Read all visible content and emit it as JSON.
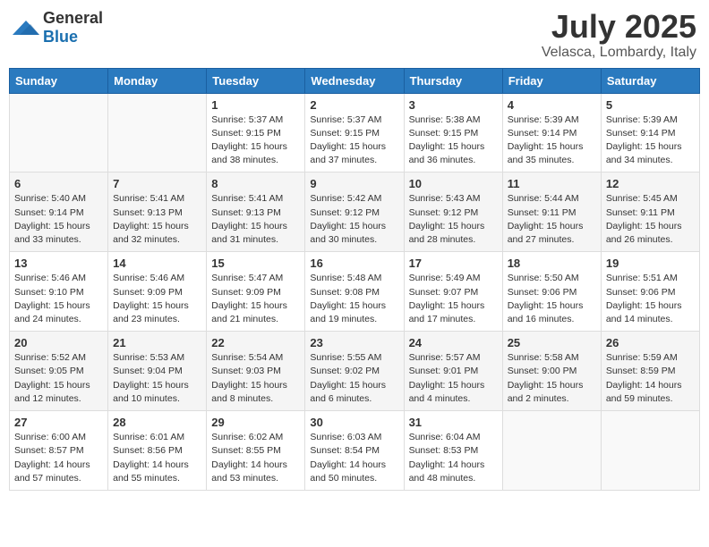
{
  "header": {
    "logo_general": "General",
    "logo_blue": "Blue",
    "month_title": "July 2025",
    "location": "Velasca, Lombardy, Italy"
  },
  "days_of_week": [
    "Sunday",
    "Monday",
    "Tuesday",
    "Wednesday",
    "Thursday",
    "Friday",
    "Saturday"
  ],
  "weeks": [
    [
      {
        "day": "",
        "sunrise": "",
        "sunset": "",
        "daylight": ""
      },
      {
        "day": "",
        "sunrise": "",
        "sunset": "",
        "daylight": ""
      },
      {
        "day": "1",
        "sunrise": "Sunrise: 5:37 AM",
        "sunset": "Sunset: 9:15 PM",
        "daylight": "Daylight: 15 hours and 38 minutes."
      },
      {
        "day": "2",
        "sunrise": "Sunrise: 5:37 AM",
        "sunset": "Sunset: 9:15 PM",
        "daylight": "Daylight: 15 hours and 37 minutes."
      },
      {
        "day": "3",
        "sunrise": "Sunrise: 5:38 AM",
        "sunset": "Sunset: 9:15 PM",
        "daylight": "Daylight: 15 hours and 36 minutes."
      },
      {
        "day": "4",
        "sunrise": "Sunrise: 5:39 AM",
        "sunset": "Sunset: 9:14 PM",
        "daylight": "Daylight: 15 hours and 35 minutes."
      },
      {
        "day": "5",
        "sunrise": "Sunrise: 5:39 AM",
        "sunset": "Sunset: 9:14 PM",
        "daylight": "Daylight: 15 hours and 34 minutes."
      }
    ],
    [
      {
        "day": "6",
        "sunrise": "Sunrise: 5:40 AM",
        "sunset": "Sunset: 9:14 PM",
        "daylight": "Daylight: 15 hours and 33 minutes."
      },
      {
        "day": "7",
        "sunrise": "Sunrise: 5:41 AM",
        "sunset": "Sunset: 9:13 PM",
        "daylight": "Daylight: 15 hours and 32 minutes."
      },
      {
        "day": "8",
        "sunrise": "Sunrise: 5:41 AM",
        "sunset": "Sunset: 9:13 PM",
        "daylight": "Daylight: 15 hours and 31 minutes."
      },
      {
        "day": "9",
        "sunrise": "Sunrise: 5:42 AM",
        "sunset": "Sunset: 9:12 PM",
        "daylight": "Daylight: 15 hours and 30 minutes."
      },
      {
        "day": "10",
        "sunrise": "Sunrise: 5:43 AM",
        "sunset": "Sunset: 9:12 PM",
        "daylight": "Daylight: 15 hours and 28 minutes."
      },
      {
        "day": "11",
        "sunrise": "Sunrise: 5:44 AM",
        "sunset": "Sunset: 9:11 PM",
        "daylight": "Daylight: 15 hours and 27 minutes."
      },
      {
        "day": "12",
        "sunrise": "Sunrise: 5:45 AM",
        "sunset": "Sunset: 9:11 PM",
        "daylight": "Daylight: 15 hours and 26 minutes."
      }
    ],
    [
      {
        "day": "13",
        "sunrise": "Sunrise: 5:46 AM",
        "sunset": "Sunset: 9:10 PM",
        "daylight": "Daylight: 15 hours and 24 minutes."
      },
      {
        "day": "14",
        "sunrise": "Sunrise: 5:46 AM",
        "sunset": "Sunset: 9:09 PM",
        "daylight": "Daylight: 15 hours and 23 minutes."
      },
      {
        "day": "15",
        "sunrise": "Sunrise: 5:47 AM",
        "sunset": "Sunset: 9:09 PM",
        "daylight": "Daylight: 15 hours and 21 minutes."
      },
      {
        "day": "16",
        "sunrise": "Sunrise: 5:48 AM",
        "sunset": "Sunset: 9:08 PM",
        "daylight": "Daylight: 15 hours and 19 minutes."
      },
      {
        "day": "17",
        "sunrise": "Sunrise: 5:49 AM",
        "sunset": "Sunset: 9:07 PM",
        "daylight": "Daylight: 15 hours and 17 minutes."
      },
      {
        "day": "18",
        "sunrise": "Sunrise: 5:50 AM",
        "sunset": "Sunset: 9:06 PM",
        "daylight": "Daylight: 15 hours and 16 minutes."
      },
      {
        "day": "19",
        "sunrise": "Sunrise: 5:51 AM",
        "sunset": "Sunset: 9:06 PM",
        "daylight": "Daylight: 15 hours and 14 minutes."
      }
    ],
    [
      {
        "day": "20",
        "sunrise": "Sunrise: 5:52 AM",
        "sunset": "Sunset: 9:05 PM",
        "daylight": "Daylight: 15 hours and 12 minutes."
      },
      {
        "day": "21",
        "sunrise": "Sunrise: 5:53 AM",
        "sunset": "Sunset: 9:04 PM",
        "daylight": "Daylight: 15 hours and 10 minutes."
      },
      {
        "day": "22",
        "sunrise": "Sunrise: 5:54 AM",
        "sunset": "Sunset: 9:03 PM",
        "daylight": "Daylight: 15 hours and 8 minutes."
      },
      {
        "day": "23",
        "sunrise": "Sunrise: 5:55 AM",
        "sunset": "Sunset: 9:02 PM",
        "daylight": "Daylight: 15 hours and 6 minutes."
      },
      {
        "day": "24",
        "sunrise": "Sunrise: 5:57 AM",
        "sunset": "Sunset: 9:01 PM",
        "daylight": "Daylight: 15 hours and 4 minutes."
      },
      {
        "day": "25",
        "sunrise": "Sunrise: 5:58 AM",
        "sunset": "Sunset: 9:00 PM",
        "daylight": "Daylight: 15 hours and 2 minutes."
      },
      {
        "day": "26",
        "sunrise": "Sunrise: 5:59 AM",
        "sunset": "Sunset: 8:59 PM",
        "daylight": "Daylight: 14 hours and 59 minutes."
      }
    ],
    [
      {
        "day": "27",
        "sunrise": "Sunrise: 6:00 AM",
        "sunset": "Sunset: 8:57 PM",
        "daylight": "Daylight: 14 hours and 57 minutes."
      },
      {
        "day": "28",
        "sunrise": "Sunrise: 6:01 AM",
        "sunset": "Sunset: 8:56 PM",
        "daylight": "Daylight: 14 hours and 55 minutes."
      },
      {
        "day": "29",
        "sunrise": "Sunrise: 6:02 AM",
        "sunset": "Sunset: 8:55 PM",
        "daylight": "Daylight: 14 hours and 53 minutes."
      },
      {
        "day": "30",
        "sunrise": "Sunrise: 6:03 AM",
        "sunset": "Sunset: 8:54 PM",
        "daylight": "Daylight: 14 hours and 50 minutes."
      },
      {
        "day": "31",
        "sunrise": "Sunrise: 6:04 AM",
        "sunset": "Sunset: 8:53 PM",
        "daylight": "Daylight: 14 hours and 48 minutes."
      },
      {
        "day": "",
        "sunrise": "",
        "sunset": "",
        "daylight": ""
      },
      {
        "day": "",
        "sunrise": "",
        "sunset": "",
        "daylight": ""
      }
    ]
  ]
}
